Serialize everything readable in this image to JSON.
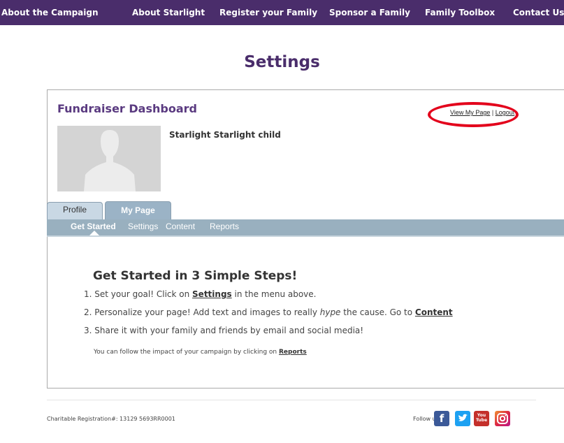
{
  "topnav": [
    {
      "label": "About the Campaign"
    },
    {
      "label": "About Starlight"
    },
    {
      "label": "Register your Family"
    },
    {
      "label": "Sponsor a Family"
    },
    {
      "label": "Family Toolbox"
    },
    {
      "label": "Contact Us"
    }
  ],
  "page": {
    "title": "Settings"
  },
  "dashboard": {
    "title": "Fundraiser Dashboard",
    "view_my_page": "View My Page",
    "separator": "|",
    "logout": "Logout",
    "username": "Starlight Starlight child"
  },
  "tabs": [
    {
      "label": "Profile"
    },
    {
      "label": "My Page"
    }
  ],
  "subnav": [
    {
      "label": "Get Started"
    },
    {
      "label": "Settings"
    },
    {
      "label": "Content"
    },
    {
      "label": "Reports"
    }
  ],
  "steps": {
    "title": "Get Started in 3 Simple Steps!",
    "step1_prefix": "1. Set your goal! Click on ",
    "step1_link": "Settings",
    "step1_suffix": " in the menu above.",
    "step2_prefix": "2. Personalize your page! Add text and images to really ",
    "step2_em": "hype",
    "step2_mid": " the cause. Go to ",
    "step2_link": "Content",
    "step3": "3. Share it with your family and friends by email and social media!",
    "note_prefix": "You can follow the impact of your campaign by clicking on ",
    "note_link": "Reports"
  },
  "footer": {
    "charity": "Charitable Registration#: 13129 5693RR0001",
    "follow": "Follow us:",
    "youtube_top": "You",
    "youtube_bottom": "Tube"
  },
  "colors": {
    "brand_purple": "#4a2d6b",
    "tab_blue": "#99b0bf",
    "highlight_red": "#e3001b"
  }
}
